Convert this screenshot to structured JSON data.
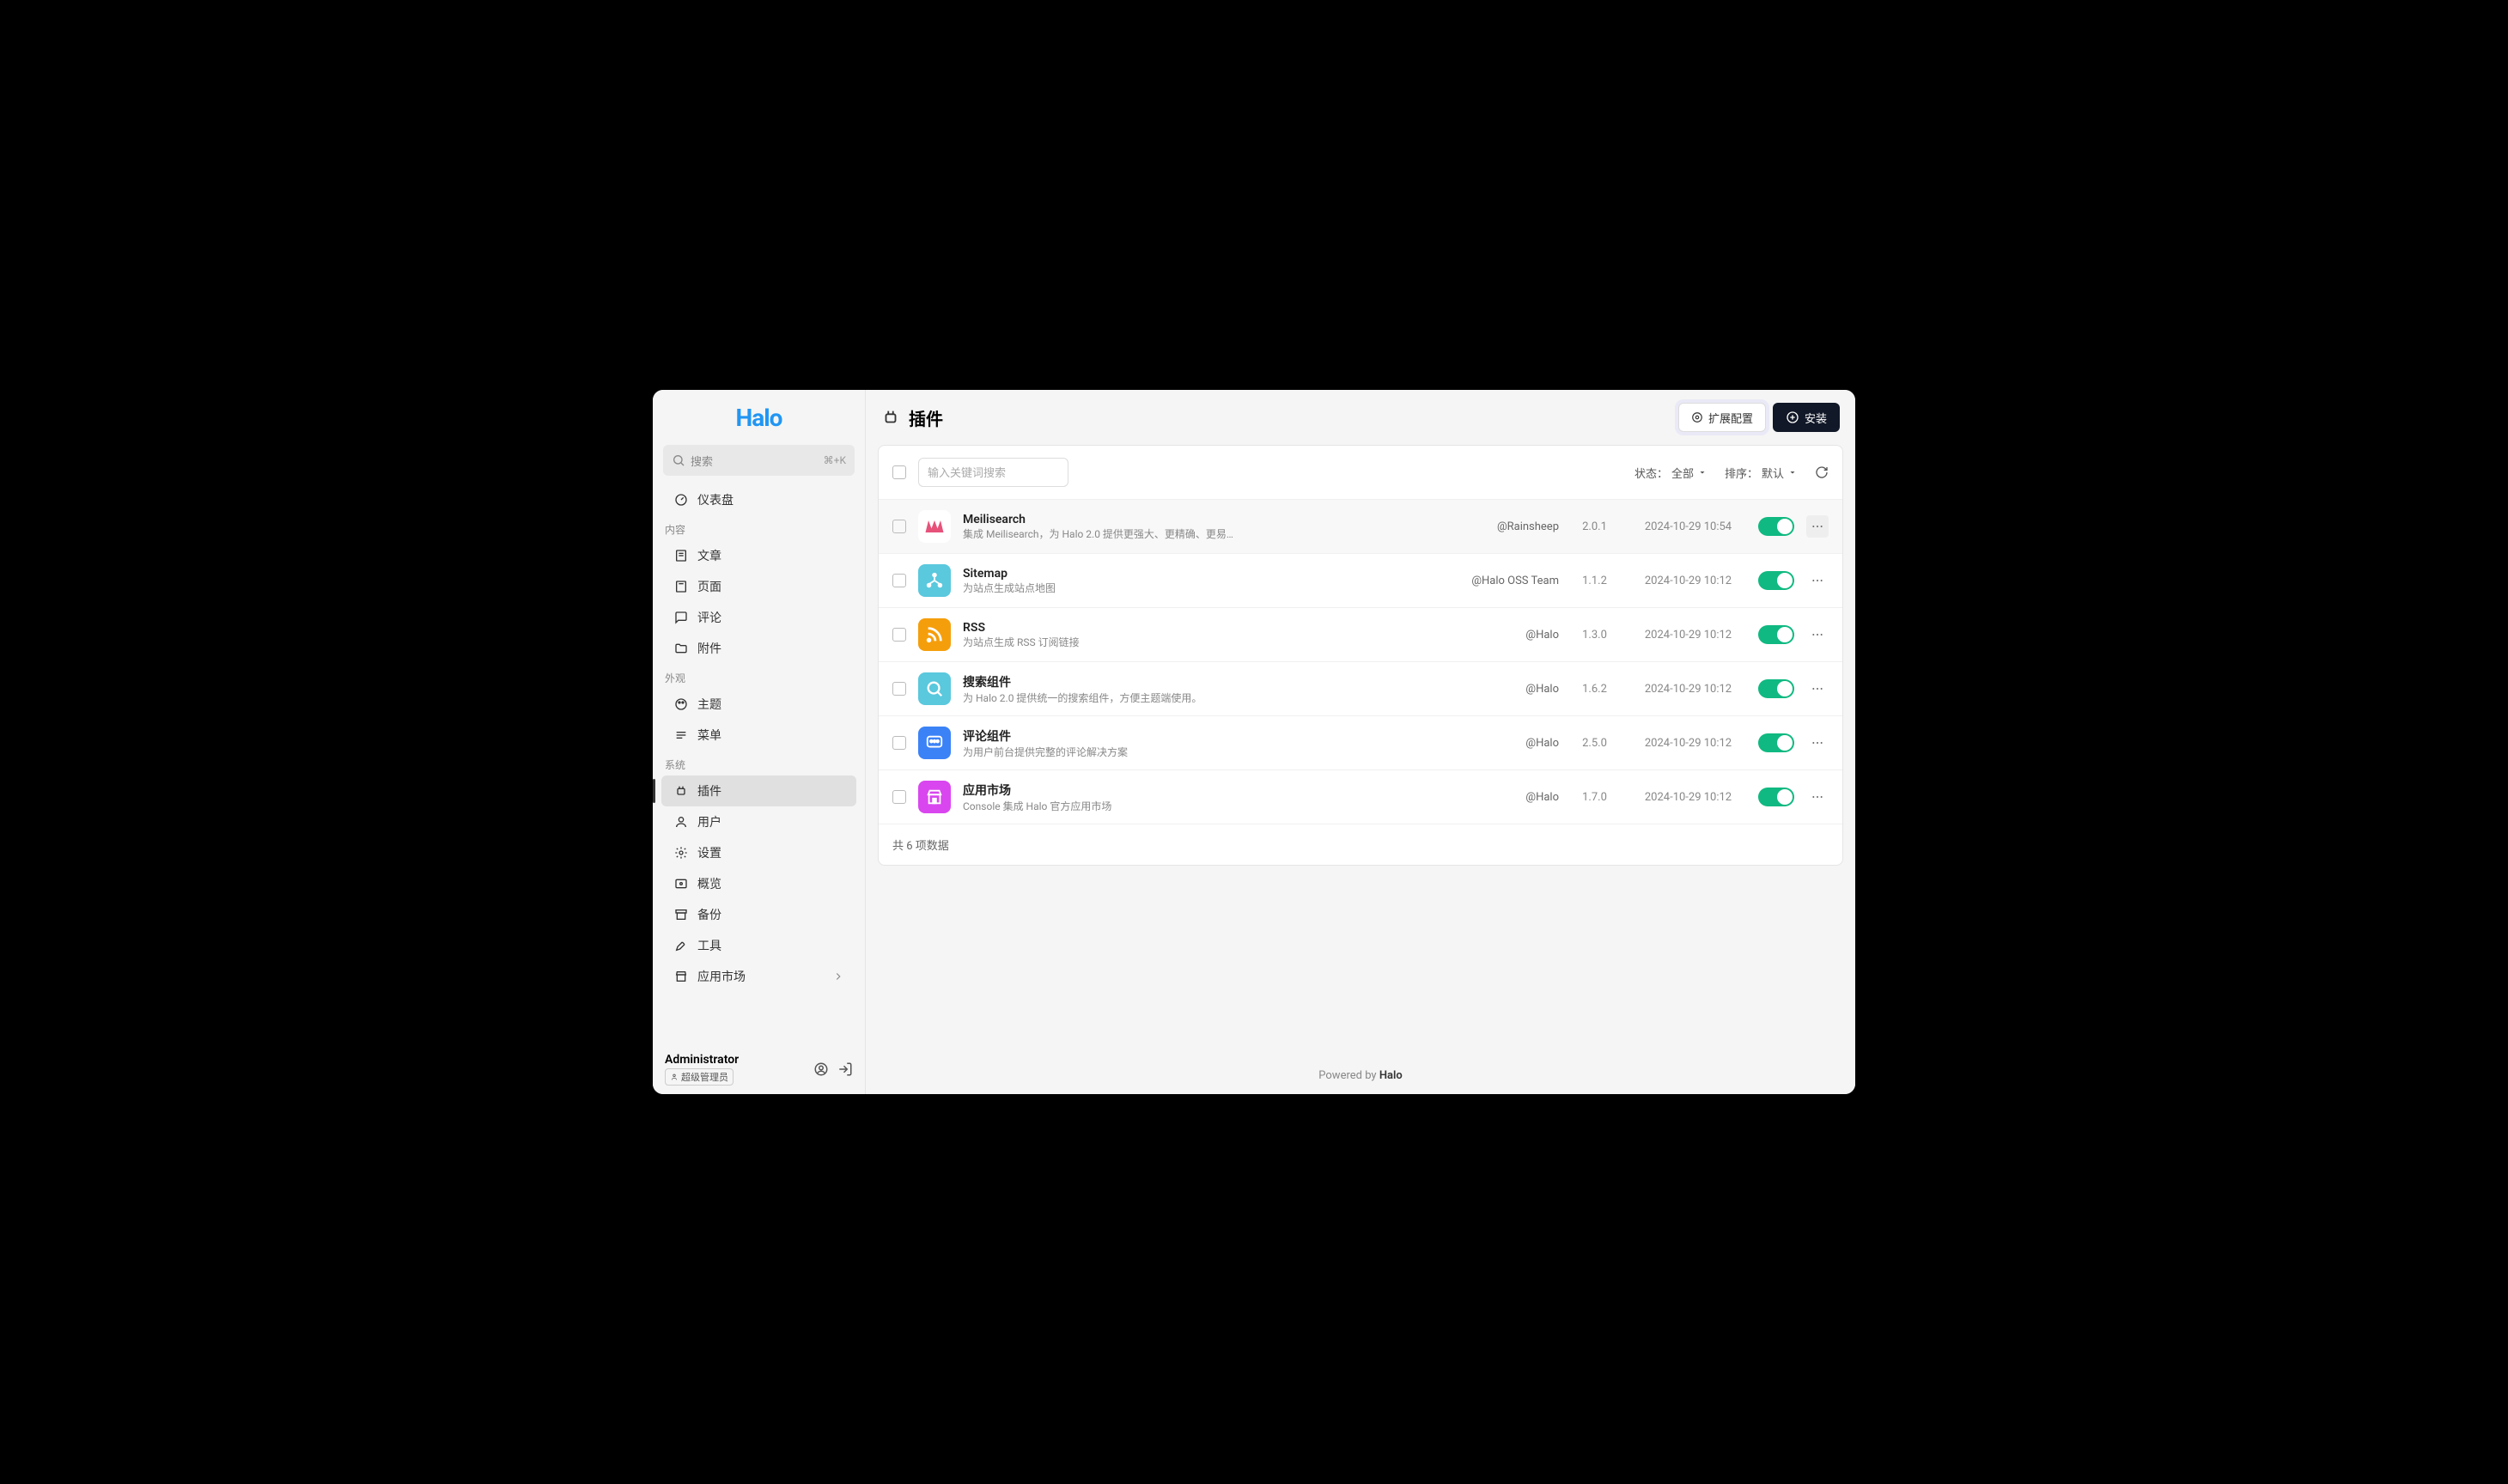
{
  "logo": "Halo",
  "search": {
    "placeholder": "搜索",
    "shortcut": "⌘+K"
  },
  "nav": {
    "dashboard": "仪表盘",
    "groups": {
      "content": "内容",
      "appearance": "外观",
      "system": "系统"
    },
    "items": {
      "posts": "文章",
      "pages": "页面",
      "comments": "评论",
      "attachments": "附件",
      "themes": "主题",
      "menus": "菜单",
      "plugins": "插件",
      "users": "用户",
      "settings": "设置",
      "overview": "概览",
      "backup": "备份",
      "tools": "工具",
      "appstore": "应用市场"
    }
  },
  "user": {
    "name": "Administrator",
    "role": "超级管理员"
  },
  "page": {
    "title": "插件",
    "ext_config": "扩展配置",
    "install": "安装"
  },
  "toolbar": {
    "search_placeholder": "输入关键词搜索",
    "status_label": "状态：",
    "status_value": "全部",
    "sort_label": "排序：",
    "sort_value": "默认"
  },
  "plugins": [
    {
      "name": "Meilisearch",
      "desc": "集成 Meilisearch，为 Halo 2.0 提供更强大、更精确、更易…",
      "author": "@Rainsheep",
      "version": "2.0.1",
      "time": "2024-10-29 10:54",
      "icon_bg": "#ffffff",
      "icon_svg": "meili"
    },
    {
      "name": "Sitemap",
      "desc": "为站点生成站点地图",
      "author": "@Halo OSS Team",
      "version": "1.1.2",
      "time": "2024-10-29 10:12",
      "icon_bg": "#5ac8dd",
      "icon_svg": "sitemap"
    },
    {
      "name": "RSS",
      "desc": "为站点生成 RSS 订阅链接",
      "author": "@Halo",
      "version": "1.3.0",
      "time": "2024-10-29 10:12",
      "icon_bg": "#f59e0b",
      "icon_svg": "rss"
    },
    {
      "name": "搜索组件",
      "desc": "为 Halo 2.0 提供统一的搜索组件，方便主题端使用。",
      "author": "@Halo",
      "version": "1.6.2",
      "time": "2024-10-29 10:12",
      "icon_bg": "#5ac8dd",
      "icon_svg": "search"
    },
    {
      "name": "评论组件",
      "desc": "为用户前台提供完整的评论解决方案",
      "author": "@Halo",
      "version": "2.5.0",
      "time": "2024-10-29 10:12",
      "icon_bg": "#3b82f6",
      "icon_svg": "comment"
    },
    {
      "name": "应用市场",
      "desc": "Console 集成 Halo 官方应用市场",
      "author": "@Halo",
      "version": "1.7.0",
      "time": "2024-10-29 10:12",
      "icon_bg": "#d946ef",
      "icon_svg": "store"
    }
  ],
  "summary": "共 6 项数据",
  "footer": {
    "powered": "Powered by ",
    "brand": "Halo"
  }
}
